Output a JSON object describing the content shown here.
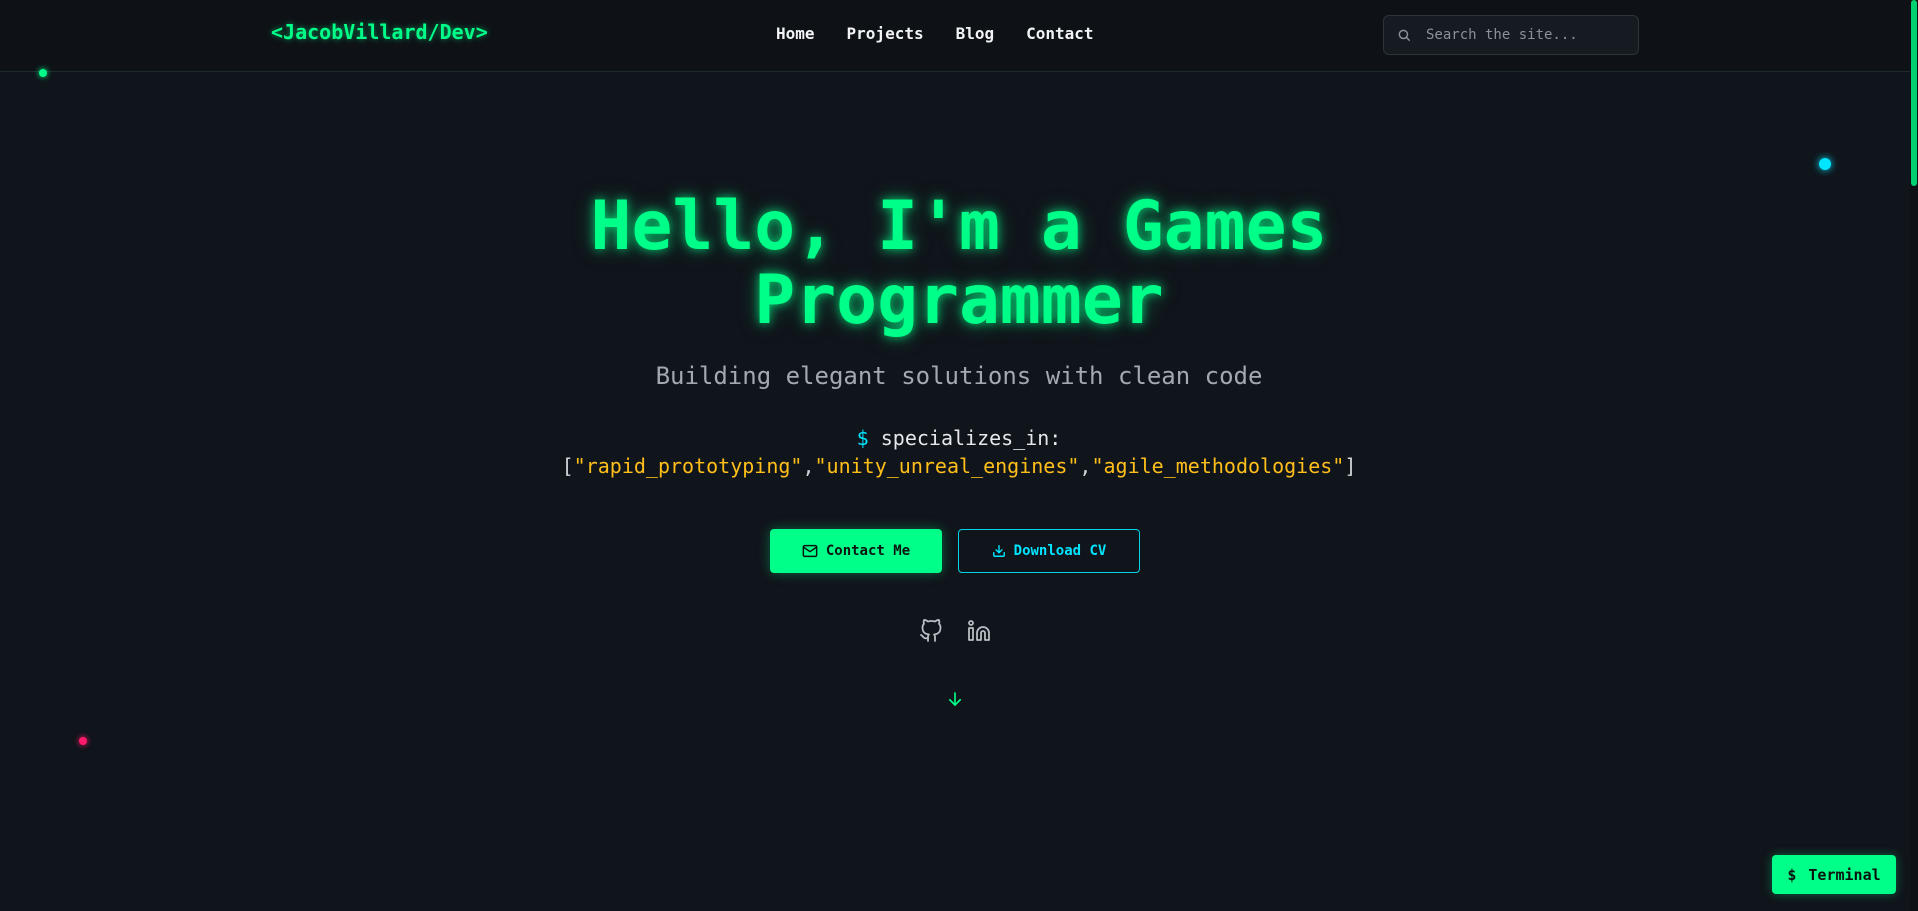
{
  "nav": {
    "brand": "<JacobVillard/Dev>",
    "links": [
      {
        "label": "Home"
      },
      {
        "label": "Projects"
      },
      {
        "label": "Blog"
      },
      {
        "label": "Contact"
      }
    ],
    "search": {
      "placeholder": "Search the site...",
      "value": "",
      "icon": "search-icon"
    }
  },
  "hero": {
    "title_line1": "Hello, I'm a Games",
    "title_line2": "Programmer",
    "subtitle": "Building elegant solutions with clean code",
    "prompt_symbol": "$",
    "spec_key": "specializes_in:",
    "specialties": [
      "\"rapid_prototyping\"",
      "\"unity_unreal_engines\"",
      "\"agile_methodologies\""
    ],
    "bracket_open": "[",
    "bracket_close": "]",
    "separator": ","
  },
  "buttons": {
    "contact": {
      "label": "Contact Me",
      "icon": "mail-icon"
    },
    "download": {
      "label": "Download CV",
      "icon": "download-icon"
    }
  },
  "social": [
    {
      "icon": "github-icon"
    },
    {
      "icon": "linkedin-icon"
    }
  ],
  "scroll_indicator": {
    "icon": "arrow-down-icon"
  },
  "terminal": {
    "symbol": "$",
    "label": "Terminal"
  },
  "colors": {
    "background": "#10141b",
    "accent_green": "#00ff88",
    "accent_cyan": "#00e5ff",
    "string_yellow": "#ffbf1a",
    "accent_pink": "#ff1a6b"
  }
}
